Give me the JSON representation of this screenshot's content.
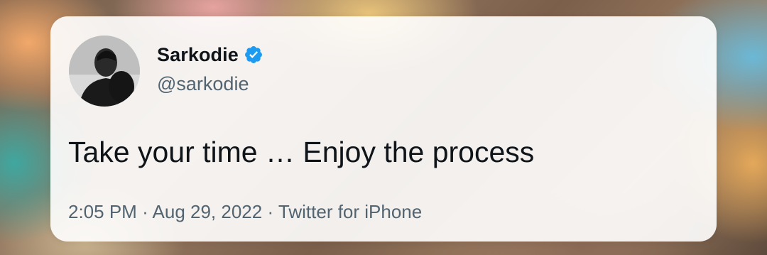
{
  "tweet": {
    "display_name": "Sarkodie",
    "handle": "@sarkodie",
    "verified": true,
    "text": "Take your time … Enjoy the process",
    "time": "2:05 PM",
    "separator": "·",
    "date": "Aug 29, 2022",
    "source": "Twitter for iPhone"
  },
  "icons": {
    "verified_badge": "verified-badge-icon"
  },
  "colors": {
    "verified_blue": "#1d9bf0",
    "text_primary": "#0f1419",
    "text_secondary": "#536471"
  }
}
